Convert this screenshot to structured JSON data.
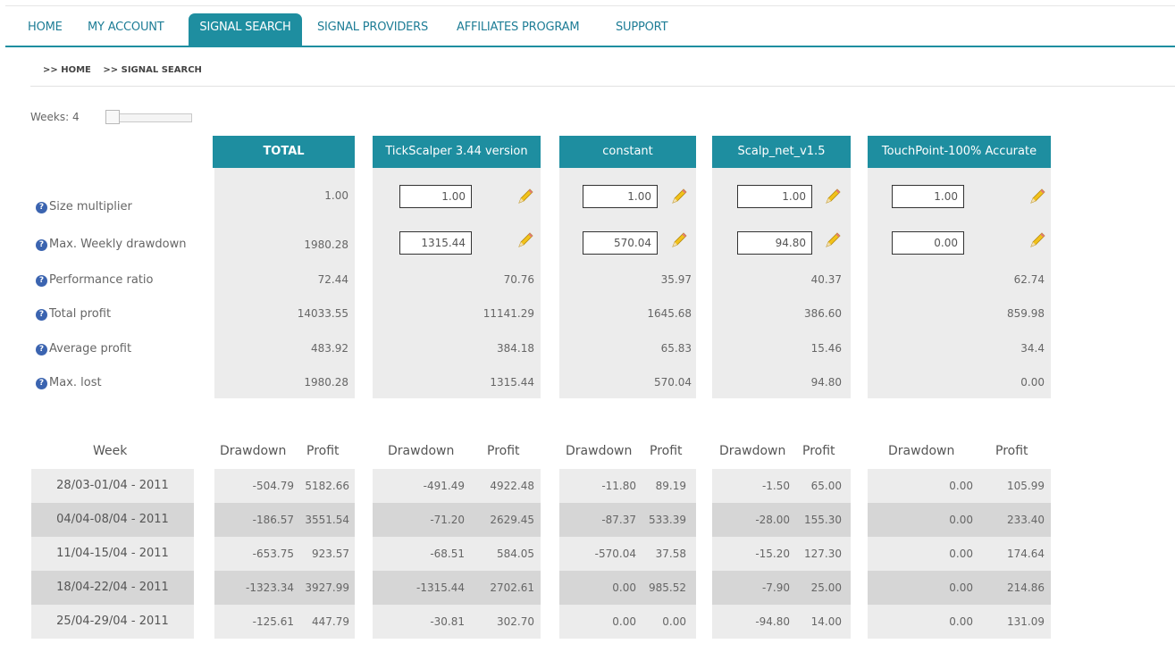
{
  "nav": {
    "items": [
      "HOME",
      "MY ACCOUNT",
      "SIGNAL SEARCH",
      "SIGNAL PROVIDERS",
      "AFFILIATES PROGRAM",
      "SUPPORT"
    ],
    "active": "SIGNAL SEARCH"
  },
  "breadcrumb": [
    ">> HOME",
    ">> SIGNAL SEARCH"
  ],
  "weeks": {
    "label": "Weeks: 4",
    "slider_value": 4
  },
  "columns": [
    "TOTAL",
    "TickScalper 3.44 version",
    "constant",
    "Scalp_net_v1.5",
    "TouchPoint-100% Accurate"
  ],
  "stats": {
    "size_multiplier": {
      "label": "Size multiplier",
      "total": "1.00",
      "inputs": [
        "1.00",
        "1.00",
        "1.00",
        "1.00"
      ]
    },
    "max_weekly_drawdown": {
      "label": "Max. Weekly drawdown",
      "total": "1980.28",
      "inputs": [
        "1315.44",
        "570.04",
        "94.80",
        "0.00"
      ]
    },
    "rows": [
      {
        "label": "Performance ratio",
        "values": [
          "72.44",
          "70.76",
          "35.97",
          "40.37",
          "62.74"
        ]
      },
      {
        "label": "Total profit",
        "values": [
          "14033.55",
          "11141.29",
          "1645.68",
          "386.60",
          "859.98"
        ]
      },
      {
        "label": "Average profit",
        "values": [
          "483.92",
          "384.18",
          "65.83",
          "15.46",
          "34.4"
        ]
      },
      {
        "label": "Max. lost",
        "values": [
          "1980.28",
          "1315.44",
          "570.04",
          "94.80",
          "0.00"
        ]
      }
    ]
  },
  "weekly": {
    "week_header": "Week",
    "drawdown_header": "Drawdown",
    "profit_header": "Profit",
    "rows": [
      {
        "week": "28/03-01/04 - 2011",
        "cells": [
          [
            "-504.79",
            "5182.66"
          ],
          [
            "-491.49",
            "4922.48"
          ],
          [
            "-11.80",
            "89.19"
          ],
          [
            "-1.50",
            "65.00"
          ],
          [
            "0.00",
            "105.99"
          ]
        ]
      },
      {
        "week": "04/04-08/04 - 2011",
        "cells": [
          [
            "-186.57",
            "3551.54"
          ],
          [
            "-71.20",
            "2629.45"
          ],
          [
            "-87.37",
            "533.39"
          ],
          [
            "-28.00",
            "155.30"
          ],
          [
            "0.00",
            "233.40"
          ]
        ]
      },
      {
        "week": "11/04-15/04 - 2011",
        "cells": [
          [
            "-653.75",
            "923.57"
          ],
          [
            "-68.51",
            "584.05"
          ],
          [
            "-570.04",
            "37.58"
          ],
          [
            "-15.20",
            "127.30"
          ],
          [
            "0.00",
            "174.64"
          ]
        ]
      },
      {
        "week": "18/04-22/04 - 2011",
        "cells": [
          [
            "-1323.34",
            "3927.99"
          ],
          [
            "-1315.44",
            "2702.61"
          ],
          [
            "0.00",
            "985.52"
          ],
          [
            "-7.90",
            "25.00"
          ],
          [
            "0.00",
            "214.86"
          ]
        ]
      },
      {
        "week": "25/04-29/04 - 2011",
        "cells": [
          [
            "-125.61",
            "447.79"
          ],
          [
            "-30.81",
            "302.70"
          ],
          [
            "0.00",
            "0.00"
          ],
          [
            "-94.80",
            "14.00"
          ],
          [
            "0.00",
            "131.09"
          ]
        ]
      }
    ]
  },
  "colors": {
    "accent": "#1e8ea0",
    "light_row": "#ececec",
    "dark_row": "#d6d6d6",
    "info_icon": "#3b64b0"
  }
}
